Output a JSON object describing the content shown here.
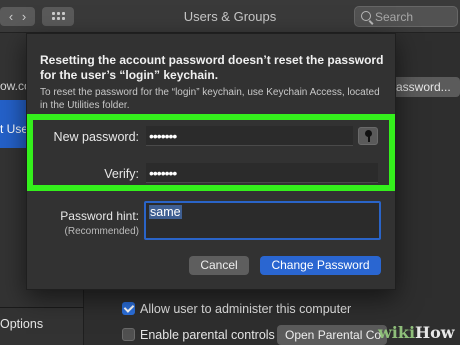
{
  "window": {
    "title": "Users & Groups",
    "back_glyph": "‹",
    "forward_glyph": "›",
    "search_placeholder": "Search"
  },
  "sidebar": {
    "fragment_text": "ow.co",
    "selected_user_fragment": "t Use",
    "options_label": "Options"
  },
  "background": {
    "password_button_label": "assword...",
    "allow_admin_label": "Allow user to administer this computer",
    "allow_admin_checked": true,
    "parental_controls_label": "Enable parental controls",
    "parental_controls_checked": false,
    "open_parental_button_label": "Open Parental Co"
  },
  "sheet": {
    "heading": "Resetting the account password doesn’t reset the password for the user’s “login” keychain.",
    "note": "To reset the password for the “login” keychain, use Keychain Access, located in the Utilities folder.",
    "new_password_label": "New password:",
    "new_password_value": "•••••••",
    "verify_label": "Verify:",
    "verify_value": "•••••••",
    "hint_label": "Password hint:",
    "hint_sublabel": "(Recommended)",
    "hint_value": "same",
    "cancel_label": "Cancel",
    "change_label": "Change Password"
  },
  "colors": {
    "highlight": "#34f01c",
    "accent": "#2a66d1"
  },
  "watermark": {
    "wiki": "wiki",
    "how": "How"
  }
}
